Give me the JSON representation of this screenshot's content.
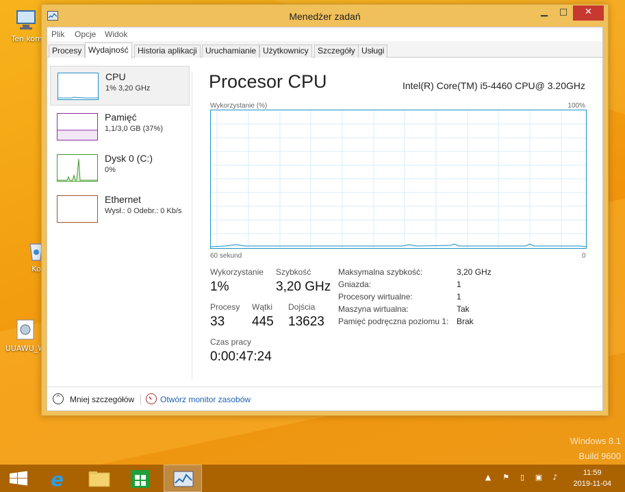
{
  "window": {
    "title": "Menedżer zadań",
    "min_glyph": "▁",
    "max_glyph": "□",
    "close_glyph": "✕"
  },
  "menu": [
    "Plik",
    "Opcje",
    "Widok"
  ],
  "tabs": [
    {
      "label": "Procesy",
      "active": false
    },
    {
      "label": "Wydajność",
      "active": true
    },
    {
      "label": "Historia aplikacji",
      "active": false
    },
    {
      "label": "Uruchamianie",
      "active": false
    },
    {
      "label": "Użytkownicy",
      "active": false
    },
    {
      "label": "Szczegóły",
      "active": false
    },
    {
      "label": "Usługi",
      "active": false
    }
  ],
  "sidebar": [
    {
      "title": "CPU",
      "sub": "1% 3,20 GHz",
      "color": "#1e90c8",
      "selected": true
    },
    {
      "title": "Pamięć",
      "sub": "1,1/3,0 GB (37%)",
      "color": "#8b2fa3",
      "selected": false
    },
    {
      "title": "Dysk 0 (C:)",
      "sub": "0%",
      "color": "#3d9b2a",
      "selected": false
    },
    {
      "title": "Ethernet",
      "sub": "Wysł.: 0 Odebr.: 0 Kb/s",
      "color": "#a0522d",
      "selected": false
    }
  ],
  "main": {
    "title": "Procesor CPU",
    "cpu_model": "Intel(R) Core(TM) i5-4460 CPU@ 3.20GHz",
    "graph_top_left": "Wykorzystanie (%)",
    "graph_top_right": "100%",
    "graph_bottom_left": "60 sekund",
    "graph_bottom_right": "0"
  },
  "stats": {
    "util_label": "Wykorzystanie",
    "util_value": "1%",
    "speed_label": "Szybkość",
    "speed_value": "3,20 GHz",
    "proc_label": "Procesy",
    "proc_value": "33",
    "threads_label": "Wątki",
    "threads_value": "445",
    "handles_label": "Dojścia",
    "handles_value": "13623",
    "uptime_label": "Czas pracy",
    "uptime_value": "0:00:47:24"
  },
  "specs": [
    {
      "label": "Maksymalna szybkość:",
      "value": "3,20 GHz"
    },
    {
      "label": "Gniazda:",
      "value": "1"
    },
    {
      "label": "Procesory wirtualne:",
      "value": "1"
    },
    {
      "label": "Maszyna wirtualna:",
      "value": "Tak"
    },
    {
      "label": "Pamięć podręczna poziomu 1:",
      "value": "Brak"
    }
  ],
  "footer": {
    "fewer_details": "Mniej szczegółów",
    "resource_monitor": "Otwórz monitor zasobów"
  },
  "desktop": {
    "icons": [
      "Ten kom",
      "Ko",
      "UUAWU_W"
    ],
    "watermark_line1": "Windows 8.1",
    "watermark_line2": "Build 9600"
  },
  "taskbar": {
    "time": "11:59",
    "date": "2019-11-04"
  },
  "colors": {
    "cpu_graph": "#1e90c8",
    "accent": "#f0a30a"
  }
}
